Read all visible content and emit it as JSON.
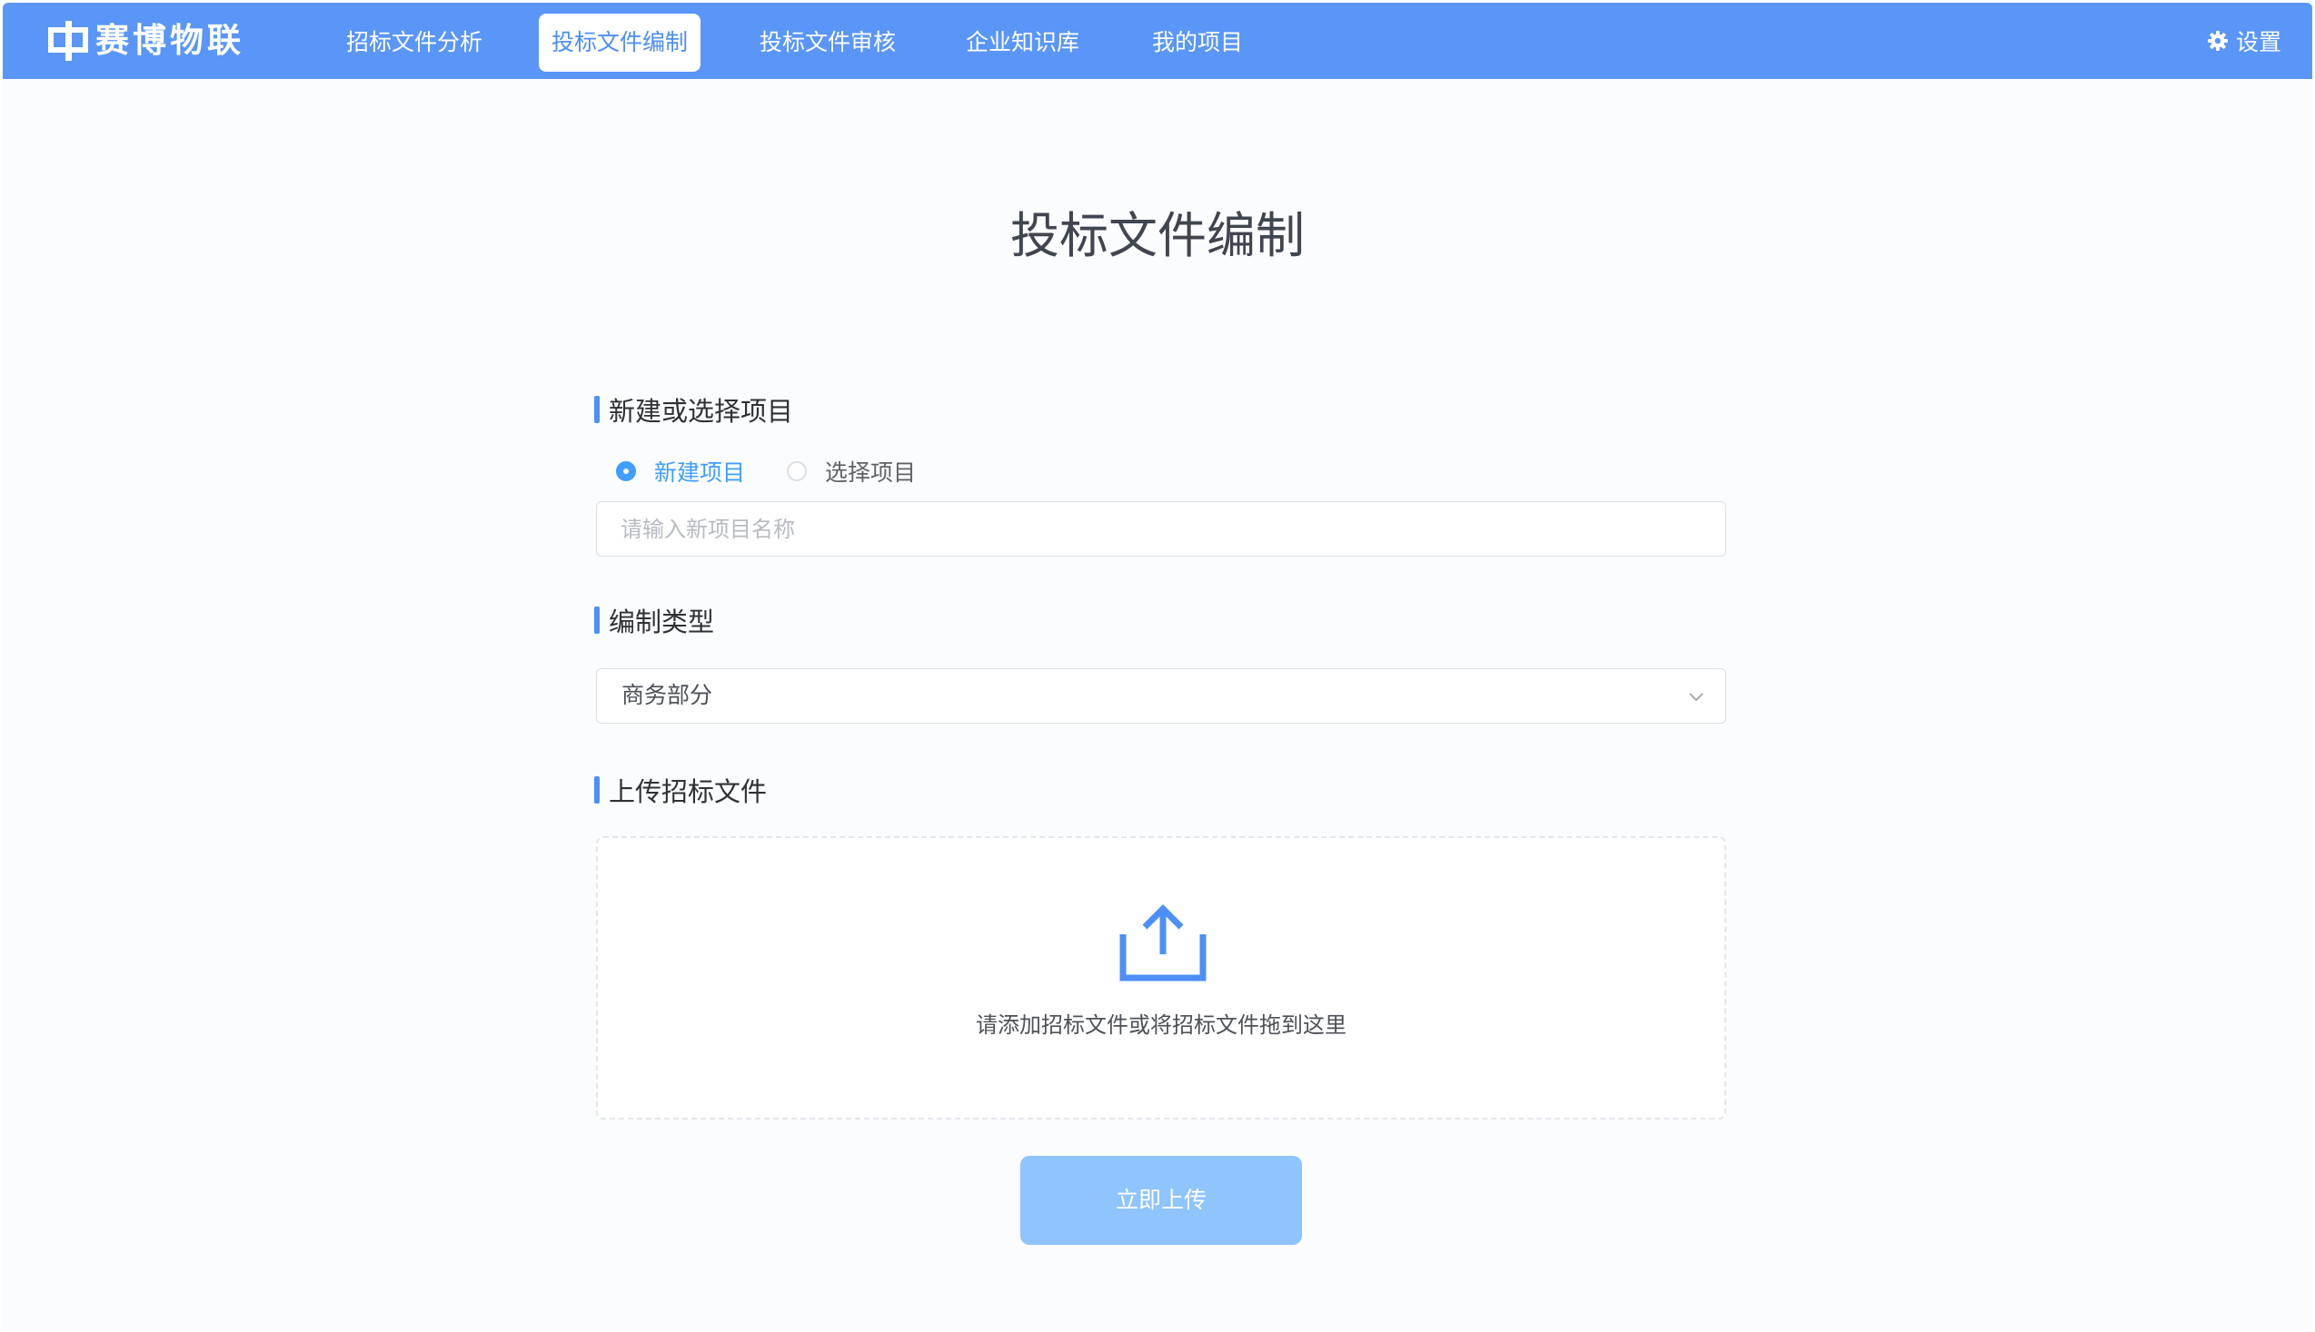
{
  "app": {
    "brand": "赛博物联",
    "logo_icon": "zhong-character-logo",
    "accent_color": "#5a96f7",
    "link_color": "#409eff"
  },
  "nav": {
    "items": [
      {
        "label": "招标文件分析",
        "active": false
      },
      {
        "label": "投标文件编制",
        "active": true
      },
      {
        "label": "投标文件审核",
        "active": false
      },
      {
        "label": "企业知识库",
        "active": false
      },
      {
        "label": "我的项目",
        "active": false
      }
    ],
    "settings_label": "设置",
    "settings_icon": "gear-icon"
  },
  "main": {
    "title": "投标文件编制",
    "project_section": {
      "title": "新建或选择项目",
      "options": [
        {
          "label": "新建项目",
          "checked": true
        },
        {
          "label": "选择项目",
          "checked": false
        }
      ],
      "name_input": {
        "value": "",
        "placeholder": "请输入新项目名称"
      }
    },
    "type_section": {
      "title": "编制类型",
      "selected": "商务部分"
    },
    "upload_section": {
      "title": "上传招标文件",
      "hint": "请添加招标文件或将招标文件拖到这里",
      "icon": "upload-icon"
    },
    "submit_label": "立即上传"
  }
}
